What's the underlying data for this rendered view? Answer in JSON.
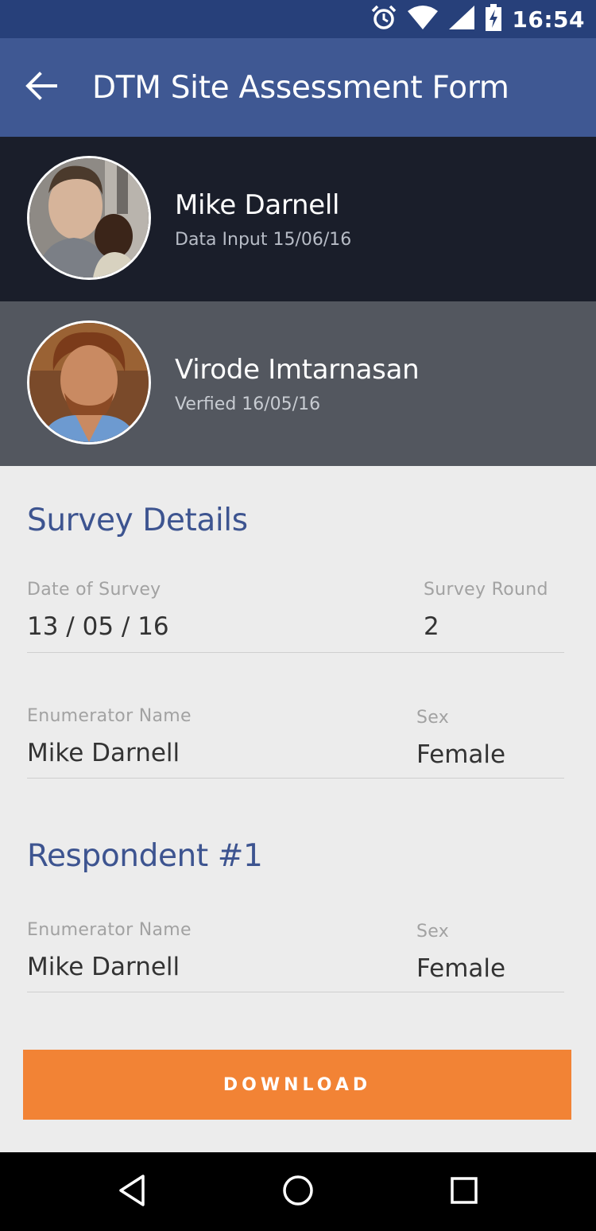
{
  "status_bar": {
    "time": "16:54",
    "icons": [
      "alarm-icon",
      "wifi-icon",
      "signal-icon",
      "battery-charging-icon"
    ]
  },
  "app_bar": {
    "title": "DTM Site Assessment Form",
    "back_icon": "arrow-left-icon"
  },
  "people": [
    {
      "name": "Mike Darnell",
      "subtitle": "Data Input 15/06/16"
    },
    {
      "name": "Virode Imtarnasan",
      "subtitle": "Verfied 16/05/16"
    }
  ],
  "survey_details": {
    "title": "Survey Details",
    "date_label": "Date of Survey",
    "date_value": "13 / 05 / 16",
    "round_label": "Survey Round",
    "round_value": "2",
    "enumerator_label": "Enumerator Name",
    "enumerator_value": "Mike Darnell",
    "sex_label": "Sex",
    "sex_value": "Female"
  },
  "respondent": {
    "title": "Respondent #1",
    "enumerator_label": "Enumerator Name",
    "enumerator_value": "Mike Darnell",
    "sex_label": "Sex",
    "sex_value": "Female"
  },
  "actions": {
    "download_label": "DOWNLOAD"
  },
  "nav_bar": {
    "icons": [
      "back-triangle-icon",
      "home-circle-icon",
      "recents-square-icon"
    ]
  },
  "colors": {
    "status_bar": "#27407a",
    "app_bar": "#3f5893",
    "accent_title": "#3d5490",
    "button": "#f28335"
  }
}
